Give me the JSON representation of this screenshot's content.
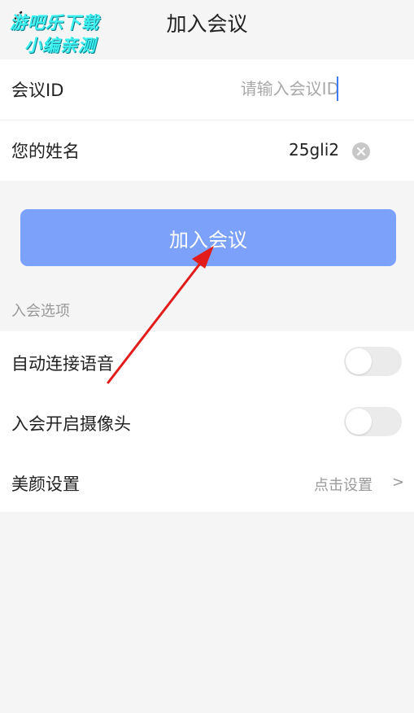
{
  "header": {
    "title": "加入会议",
    "back_icon": "chevron-left-icon"
  },
  "watermark": {
    "line1": "游吧乐下载",
    "line2": "小编亲测",
    "color": "#3ff0f0"
  },
  "form": {
    "meeting_id_label": "会议ID",
    "meeting_id_placeholder": "请输入会议ID",
    "meeting_id_value": "",
    "name_label": "您的姓名",
    "name_value": "25gli2",
    "clear_icon": "clear-circle-icon"
  },
  "join_button": {
    "label": "加入会议",
    "color": "#7ba1fb"
  },
  "options": {
    "section_title": "入会选项",
    "auto_audio_label": "自动连接语音",
    "auto_audio_on": false,
    "camera_label": "入会开启摄像头",
    "camera_on": false,
    "beauty_label": "美颜设置",
    "beauty_value": "点击设置",
    "chevron": ">"
  },
  "annotation": {
    "arrow_color": "#e21b1b"
  }
}
